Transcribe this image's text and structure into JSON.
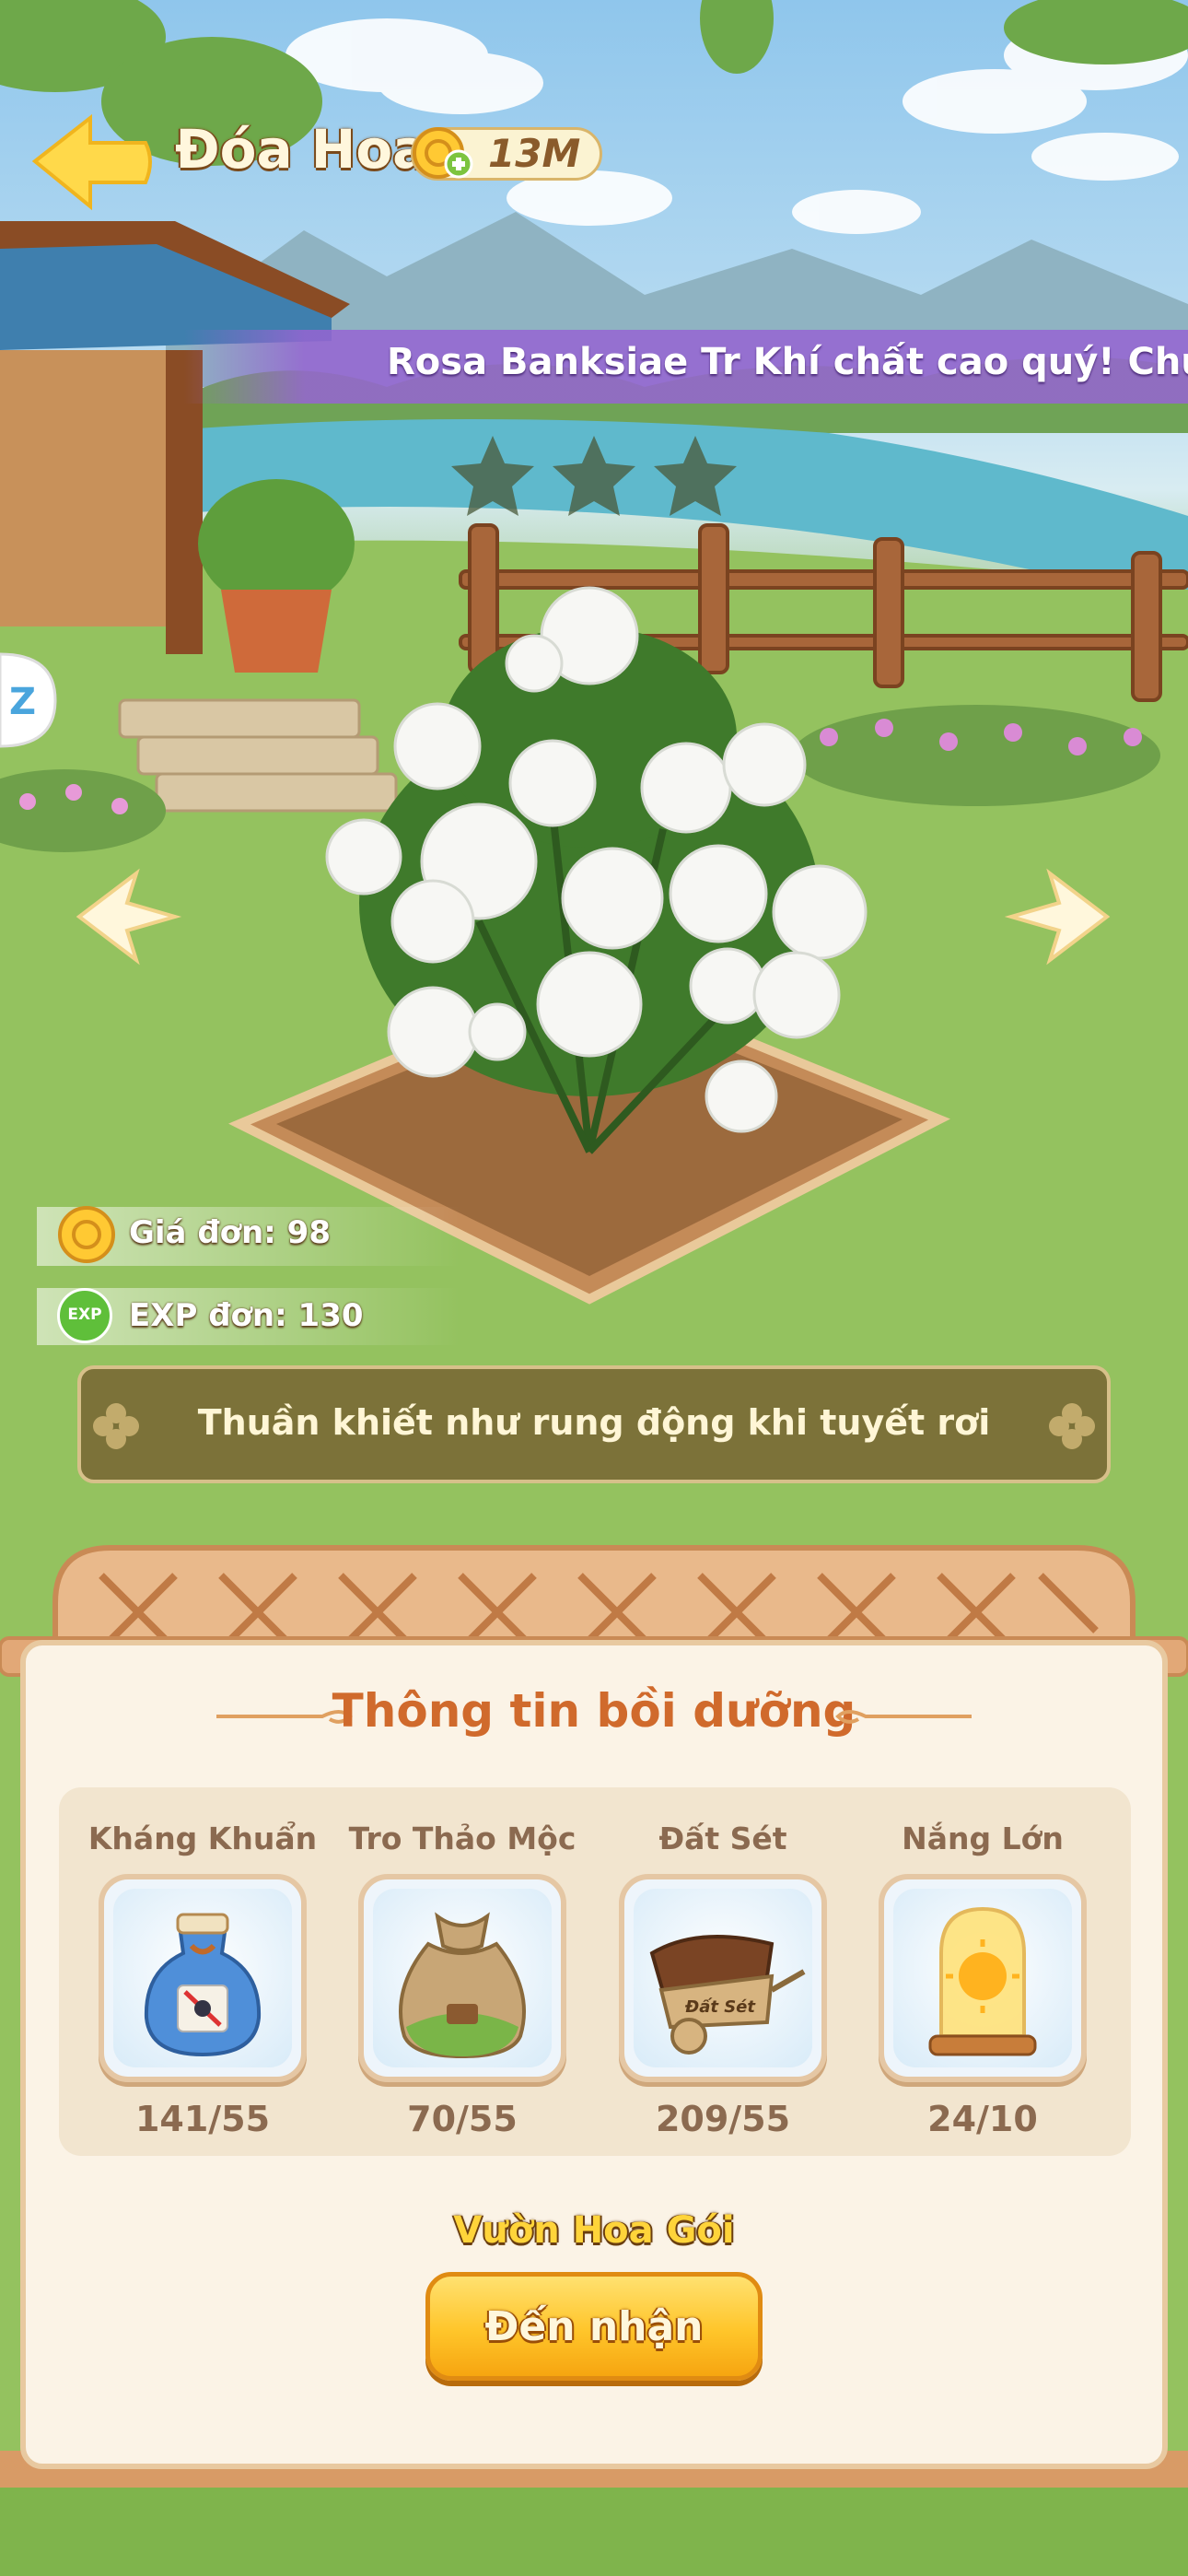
{
  "header": {
    "title": "Đóa Hoa",
    "currency_amount": "13M",
    "back_icon": "back-arrow-icon",
    "currency_icon": "gold-coin-plus-icon"
  },
  "banner": {
    "text": "Rosa Banksiae Tr Khí chất cao quý! Chúc mù"
  },
  "flower": {
    "stars": 3,
    "prev_icon": "chevron-left-icon",
    "next_icon": "chevron-right-icon"
  },
  "stats": {
    "price_label": "Giá đơn: 98",
    "exp_label": "EXP đơn: 130",
    "exp_badge": "EXP"
  },
  "description": "Thuần khiết như rung động khi tuyết rơi",
  "panel": {
    "title": "Thông tin bồi dưỡng",
    "items": [
      {
        "name": "Kháng Khuẩn",
        "count": "141/55",
        "icon": "antibacterial-bottle-icon"
      },
      {
        "name": "Tro Thảo Mộc",
        "count": "70/55",
        "icon": "herb-ash-sack-icon"
      },
      {
        "name": "Đất Sét",
        "count": "209/55",
        "icon": "clay-wheelbarrow-icon",
        "icon_text": "Đất Sét"
      },
      {
        "name": "Nắng Lớn",
        "count": "24/10",
        "icon": "sun-jar-icon"
      }
    ],
    "pack_label": "Vườn Hoa Gói",
    "claim_button": "Đến nhận"
  },
  "colors": {
    "panel_title": "#d06a2c",
    "claim_button": "#ffc52a",
    "banner": "#9664d2"
  }
}
